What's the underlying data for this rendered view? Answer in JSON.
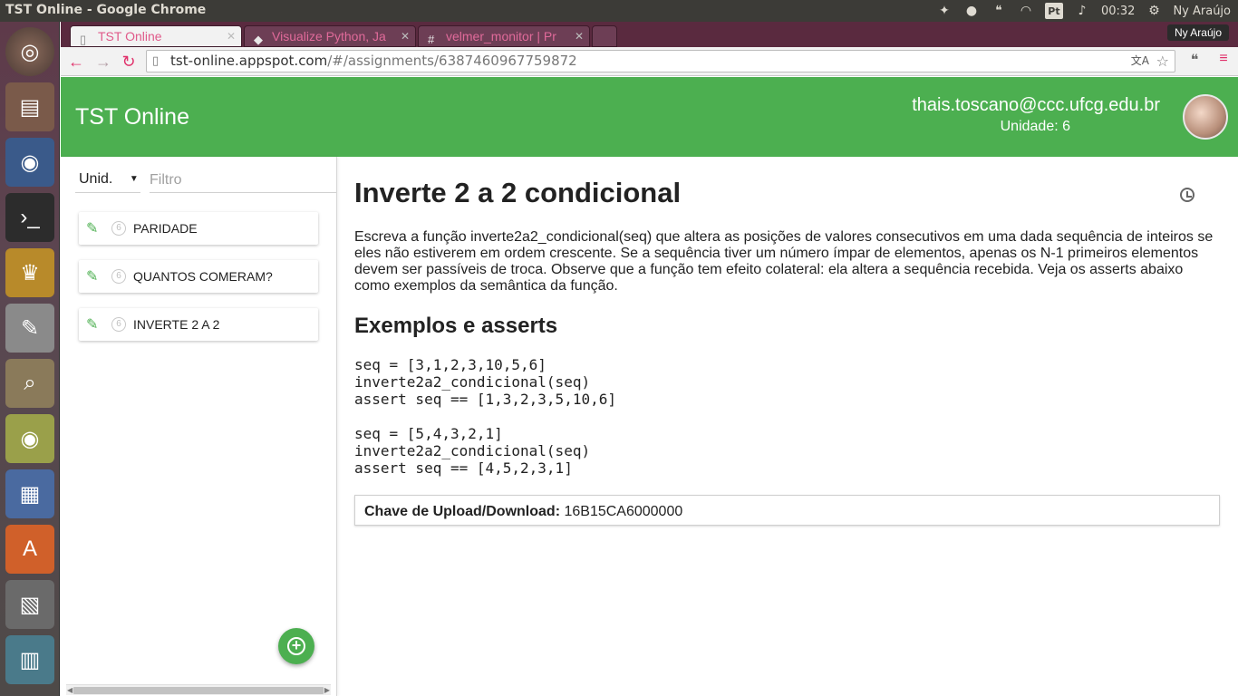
{
  "os_panel": {
    "window_title": "TST Online - Google Chrome",
    "clock": "00:32",
    "user": "Ny Araújo",
    "keyboard_layout": "Pt"
  },
  "browser": {
    "tabs": [
      {
        "title": "TST Online",
        "icon": "page-icon",
        "active": true
      },
      {
        "title": "Visualize Python, Ja",
        "icon": "python-icon",
        "active": false
      },
      {
        "title": "velmer_monitor | Pr",
        "icon": "hash-icon",
        "active": false
      }
    ],
    "profile_name": "Ny Araújo",
    "url_host": "tst-online.appspot.com",
    "url_path": "/#/assignments/6387460967759872"
  },
  "app": {
    "title": "TST Online",
    "user_email": "thais.toscano@ccc.ufcg.edu.br",
    "user_unit": "Unidade: 6",
    "brand_color": "#4caf50"
  },
  "sidebar": {
    "unit_select": "Unid.",
    "filter_placeholder": "Filtro",
    "items": [
      {
        "badge": "6",
        "label": "PARIDADE"
      },
      {
        "badge": "6",
        "label": "QUANTOS COMERAM?"
      },
      {
        "badge": "6",
        "label": "INVERTE 2 A 2"
      }
    ]
  },
  "assignment": {
    "title": "Inverte 2 a 2 condicional",
    "description": "Escreva a função inverte2a2_condicional(seq) que altera as posições de valores consecutivos em uma dada sequência de inteiros se eles não estiverem em ordem crescente. Se a sequência tiver um número ímpar de elementos, apenas os N-1 primeiros elementos devem ser passíveis de troca. Observe que a função tem efeito colateral: ela altera a sequência recebida. Veja os asserts abaixo como exemplos da semântica da função.",
    "examples_heading": "Exemplos e asserts",
    "code": "seq = [3,1,2,3,10,5,6]\ninverte2a2_condicional(seq)\nassert seq == [1,3,2,3,5,10,6]\n\nseq = [5,4,3,2,1]\ninverte2a2_condicional(seq)\nassert seq == [4,5,2,3,1]",
    "key_label": "Chave de Upload/Download:",
    "key_value": "16B15CA6000000"
  }
}
